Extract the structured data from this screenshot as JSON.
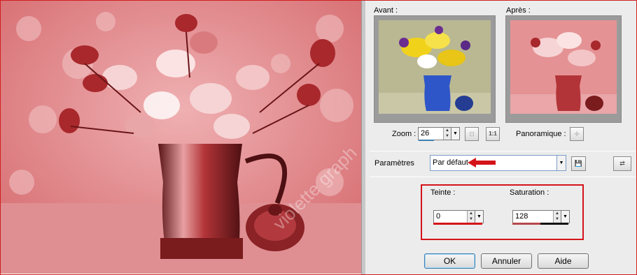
{
  "preview": {
    "before_label": "Avant :",
    "after_label": "Après :",
    "watermark": "violette graph"
  },
  "zoom": {
    "label": "Zoom :",
    "value": "26",
    "one_to_one": "1:1"
  },
  "pan": {
    "label": "Panoramique :"
  },
  "params": {
    "label": "Paramètres",
    "selected": "Par défaut"
  },
  "hue": {
    "label": "Teinte :",
    "value": "0"
  },
  "saturation": {
    "label": "Saturation :",
    "value": "128"
  },
  "buttons": {
    "ok": "OK",
    "cancel": "Annuler",
    "help": "Aide"
  },
  "colors": {
    "accent_red": "#d4141a",
    "tint": "#d9545a",
    "focus_blue": "#3c7fb1"
  }
}
